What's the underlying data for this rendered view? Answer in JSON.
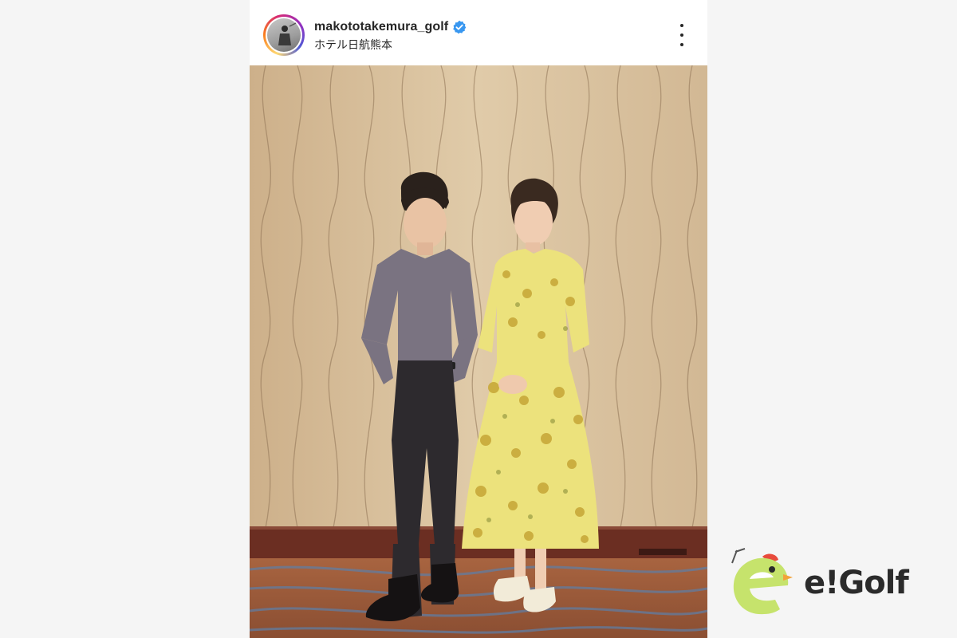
{
  "post": {
    "username": "makototakemura_golf",
    "location": "ホテル日航熊本",
    "verified": true
  },
  "icons": {
    "verified": "verified-badge-icon",
    "more": "more-options-icon"
  },
  "logo": {
    "text": "e!Golf"
  },
  "colors": {
    "verified_blue": "#3897f0",
    "logo_green": "#c6e36c",
    "logo_text": "#2b2b2b"
  }
}
